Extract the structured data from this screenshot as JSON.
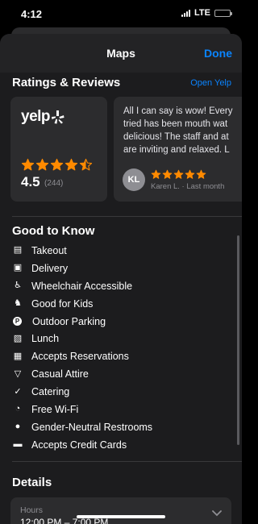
{
  "status_bar": {
    "time": "4:12",
    "network": "LTE"
  },
  "nav": {
    "title": "Maps",
    "done_label": "Done"
  },
  "ratings": {
    "header": "Ratings & Reviews",
    "open_link": "Open Yelp",
    "provider": "yelp",
    "score": "4.5",
    "count": "(244)",
    "stars_rating": 4.5
  },
  "review": {
    "lines": [
      "All I can say is wow! Every",
      "tried has been mouth wat",
      "delicious! The staff and at",
      "are inviting and relaxed. L"
    ],
    "author_initials": "KL",
    "stars_rating": 5,
    "meta": "Karen L. · Last month"
  },
  "good_to_know": {
    "title": "Good to Know",
    "items": [
      {
        "label": "Takeout",
        "icon": "takeout-bag-icon"
      },
      {
        "label": "Delivery",
        "icon": "box-icon"
      },
      {
        "label": "Wheelchair Accessible",
        "icon": "wheelchair-icon"
      },
      {
        "label": "Good for Kids",
        "icon": "rocking-horse-icon"
      },
      {
        "label": "Outdoor Parking",
        "icon": "parking-icon"
      },
      {
        "label": "Lunch",
        "icon": "takeout-box-icon"
      },
      {
        "label": "Accepts Reservations",
        "icon": "calendar-icon"
      },
      {
        "label": "Casual Attire",
        "icon": "shirt-icon"
      },
      {
        "label": "Catering",
        "icon": "checkmark-icon"
      },
      {
        "label": "Free Wi-Fi",
        "icon": "wifi-icon"
      },
      {
        "label": "Gender-Neutral Restrooms",
        "icon": "person-icon"
      },
      {
        "label": "Accepts Credit Cards",
        "icon": "credit-card-icon"
      }
    ]
  },
  "details": {
    "title": "Details",
    "hours_label": "Hours",
    "hours_value": "12:00 PM – 7:00 PM"
  },
  "colors": {
    "accent": "#0a84ff",
    "star": "#ff8a00",
    "background": "#1c1c1e",
    "card": "#2c2c2e"
  }
}
